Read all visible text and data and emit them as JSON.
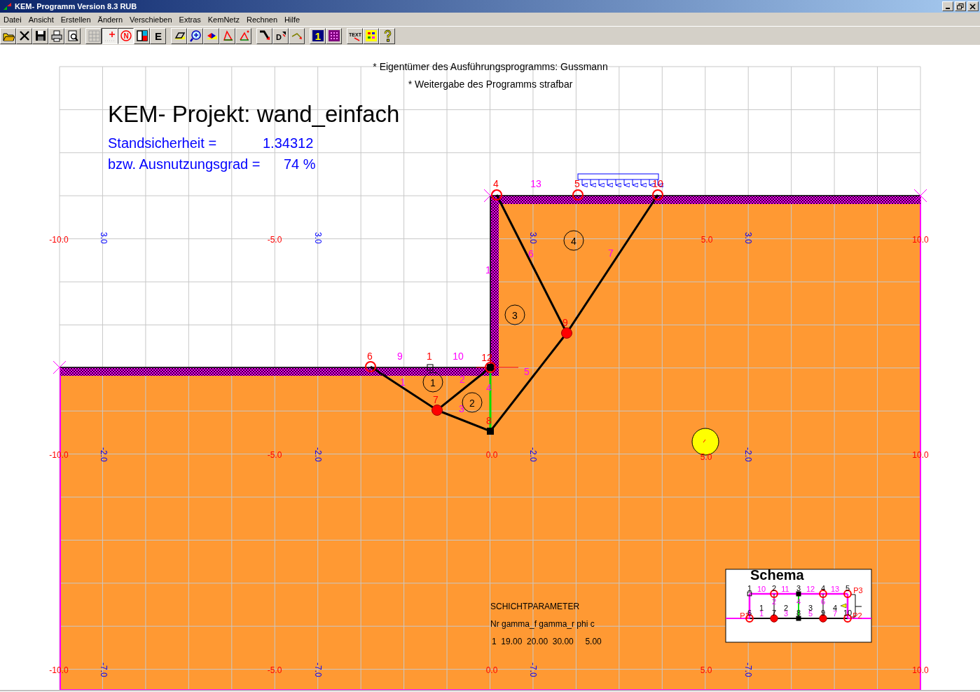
{
  "window": {
    "title": "KEM- Programm Version 8.3 RUB"
  },
  "menu": [
    "Datei",
    "Ansicht",
    "Erstellen",
    "Ändern",
    "Verschieben",
    "Extras",
    "KemNetz",
    "Rechnen",
    "Hilfe"
  ],
  "toolbar": {
    "groups": [
      {
        "buttons": [
          {
            "kind": "open",
            "pressed": false
          },
          {
            "kind": "delete",
            "pressed": false
          },
          {
            "kind": "save",
            "pressed": false
          },
          {
            "kind": "print",
            "pressed": false
          },
          {
            "kind": "preview",
            "pressed": false
          }
        ]
      },
      {
        "buttons": [
          {
            "kind": "grid",
            "pressed": false
          },
          {
            "kind": "point",
            "pressed": true
          },
          {
            "kind": "letter-circle",
            "label": "N",
            "pressed": true
          },
          {
            "kind": "split",
            "pressed": false
          },
          {
            "kind": "letter",
            "label": "E",
            "pressed": false
          }
        ]
      },
      {
        "buttons": [
          {
            "kind": "parallelogram",
            "pressed": false
          },
          {
            "kind": "zoom",
            "pressed": false
          },
          {
            "kind": "bowtie",
            "pressed": false
          },
          {
            "kind": "angle",
            "pressed": false
          },
          {
            "kind": "angle-plus",
            "pressed": false
          }
        ]
      },
      {
        "buttons": [
          {
            "kind": "arrow-corner",
            "pressed": false
          },
          {
            "kind": "letter-arrow",
            "label": "D",
            "pressed": false
          },
          {
            "kind": "line-arrow",
            "pressed": false
          }
        ]
      },
      {
        "buttons": [
          {
            "kind": "number",
            "label": "1",
            "pressed": false
          },
          {
            "kind": "dots",
            "pressed": false
          }
        ]
      },
      {
        "buttons": [
          {
            "kind": "text-arrow",
            "label": "TEXT",
            "pressed": false
          },
          {
            "kind": "colors",
            "pressed": false
          },
          {
            "kind": "help",
            "pressed": false
          }
        ]
      }
    ]
  },
  "canvas": {
    "notices": [
      "* Eigentümer des Ausführungsprogramms: Gussmann",
      "* Weitergabe des Programms strafbar"
    ],
    "project_title": "KEM- Projekt: wand_einfach",
    "results": [
      {
        "label": "Standsicherheit =",
        "value": "1.34312"
      },
      {
        "label": "bzw. Ausnutzungsgrad =",
        "value": "74 %"
      }
    ],
    "axis_labels": [
      {
        "text": "-10.0",
        "kind": "coordinate"
      },
      {
        "text": "-5.0",
        "kind": "coordinate"
      },
      {
        "text": "5.0",
        "kind": "coordinate"
      },
      {
        "text": "10.0",
        "kind": "coordinate"
      },
      {
        "text": "-10.0",
        "kind": "coordinate"
      },
      {
        "text": "-5.0",
        "kind": "coordinate"
      },
      {
        "text": "0.0",
        "kind": "coordinate"
      },
      {
        "text": "5.0",
        "kind": "coordinate"
      },
      {
        "text": "10.0",
        "kind": "coordinate"
      },
      {
        "text": "-10.0",
        "kind": "coordinate"
      },
      {
        "text": "-5.0",
        "kind": "coordinate"
      },
      {
        "text": "0.0",
        "kind": "coordinate"
      },
      {
        "text": "5.0",
        "kind": "coordinate"
      },
      {
        "text": "10.0",
        "kind": "coordinate"
      },
      {
        "text": "3.0",
        "kind": "depth"
      },
      {
        "text": "3.0",
        "kind": "depth"
      },
      {
        "text": "3.0",
        "kind": "depth"
      },
      {
        "text": "3.0",
        "kind": "depth"
      },
      {
        "text": "-2.0",
        "kind": "depth"
      },
      {
        "text": "-2.0",
        "kind": "depth"
      },
      {
        "text": "-2.0",
        "kind": "depth"
      },
      {
        "text": "-2.0",
        "kind": "depth"
      },
      {
        "text": "-7.0",
        "kind": "depth"
      },
      {
        "text": "-7.0",
        "kind": "depth"
      },
      {
        "text": "-7.0",
        "kind": "depth"
      },
      {
        "text": "-7.0",
        "kind": "depth"
      }
    ],
    "nodes": [
      {
        "label": "1",
        "kind": "hollow-square"
      },
      {
        "label": "4",
        "kind": "open"
      },
      {
        "label": "5",
        "kind": "open"
      },
      {
        "label": "10",
        "kind": "open"
      },
      {
        "label": "6",
        "kind": "open"
      },
      {
        "label": "7",
        "kind": "filled"
      },
      {
        "label": "8",
        "kind": "square"
      },
      {
        "label": "9",
        "kind": "filled"
      },
      {
        "label": "12",
        "kind": "square-ring"
      }
    ],
    "bar_labels": [
      "13",
      "9",
      "10",
      "5",
      "6",
      "7",
      "1",
      "2",
      "3",
      "4",
      "1"
    ],
    "elements": [
      "1",
      "2",
      "3",
      "4"
    ],
    "layer_parameters": {
      "title": "SCHICHTPARAMETER",
      "header": "Nr gamma_f gamma_r phi c",
      "rows": [
        "1  19.00  20.00  30.00     5.00"
      ]
    },
    "schema": {
      "title": "Schema",
      "nodes": [
        {
          "label": "1",
          "kind": "hollow-square"
        },
        {
          "label": "2",
          "kind": "open"
        },
        {
          "label": "3",
          "kind": "square"
        },
        {
          "label": "4",
          "kind": "open"
        },
        {
          "label": "5",
          "kind": "open"
        },
        {
          "label": "6",
          "kind": "open"
        },
        {
          "label": "7",
          "kind": "filled"
        },
        {
          "label": "8",
          "kind": "square"
        },
        {
          "label": "9",
          "kind": "filled"
        },
        {
          "label": "10",
          "kind": "open"
        }
      ],
      "labels": [
        {
          "text": "10",
          "kind": "bar"
        },
        {
          "text": "11",
          "kind": "bar"
        },
        {
          "text": "12",
          "kind": "bar"
        },
        {
          "text": "13",
          "kind": "bar"
        },
        {
          "text": "2",
          "kind": "bar"
        },
        {
          "text": "4",
          "kind": "bar"
        },
        {
          "text": "6",
          "kind": "bar"
        },
        {
          "text": "1",
          "kind": "element"
        },
        {
          "text": "2",
          "kind": "element"
        },
        {
          "text": "3",
          "kind": "element"
        },
        {
          "text": "4",
          "kind": "element"
        },
        {
          "text": "1",
          "kind": "bar"
        },
        {
          "text": "3",
          "kind": "bar"
        },
        {
          "text": "5",
          "kind": "bar"
        },
        {
          "text": "7",
          "kind": "bar"
        },
        {
          "text": "P3",
          "kind": "support"
        },
        {
          "text": "P1",
          "kind": "support"
        },
        {
          "text": "P2",
          "kind": "support"
        }
      ]
    }
  }
}
